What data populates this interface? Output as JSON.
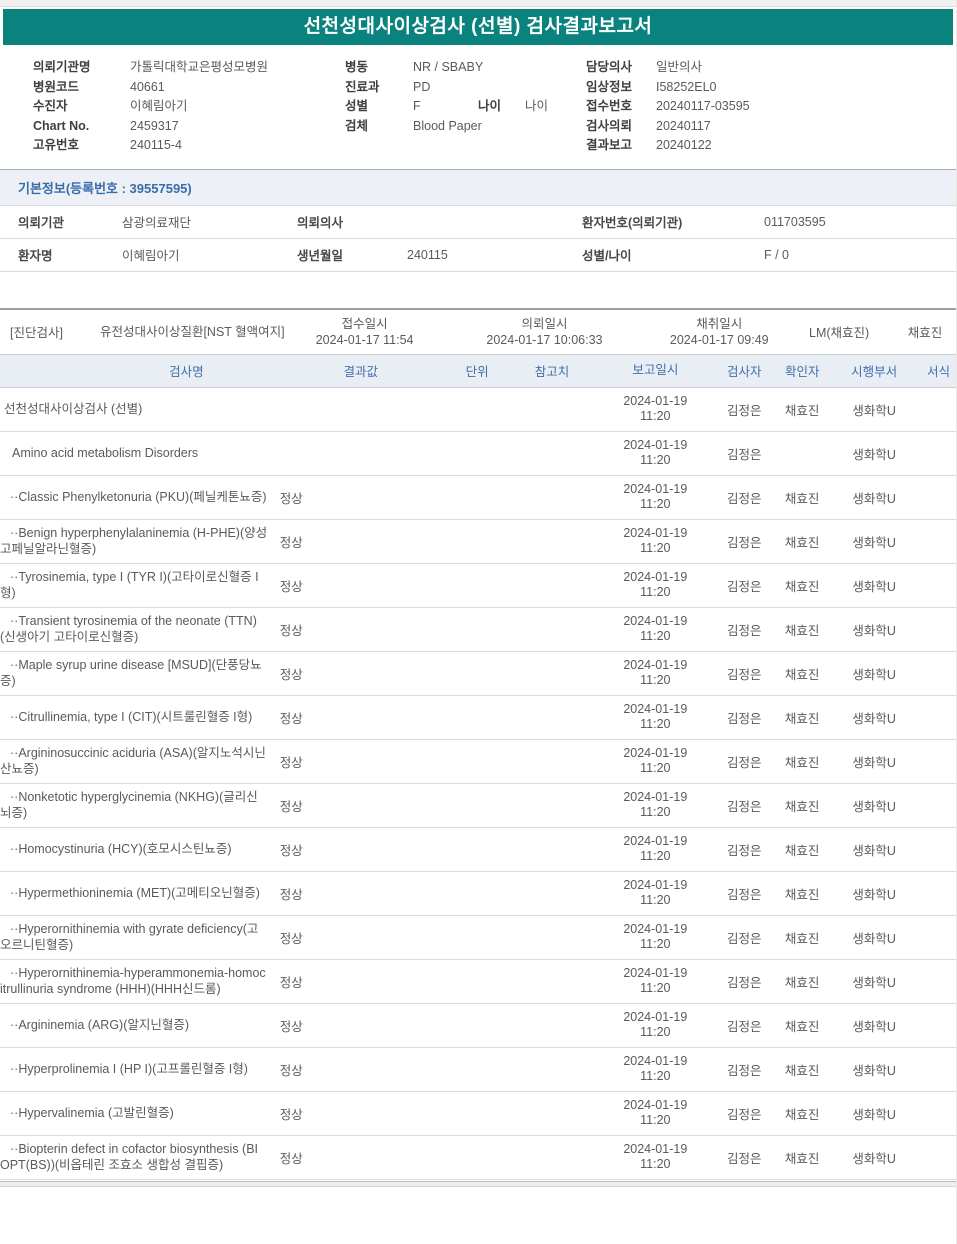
{
  "report_title": "선천성대사이상검사 (선별) 검사결과보고서",
  "colors": {
    "header_teal": "#0A827E",
    "section_title_blue": "#3A6CA9",
    "table_header_blue": "#4070AC",
    "body_text": "#595A5C"
  },
  "patient_header": {
    "col1": [
      {
        "l": "의뢰기관명",
        "v": "가톨릭대학교은평성모병원"
      },
      {
        "l": "병원코드",
        "v": "40661"
      },
      {
        "l": "수진자",
        "v": "이혜림아기"
      },
      {
        "l": "Chart No.",
        "v": "2459317"
      },
      {
        "l": "고유번호",
        "v": "240115-4"
      }
    ],
    "col2": [
      {
        "l": "병동",
        "v": "NR / SBABY",
        "l2": "",
        "v2": ""
      },
      {
        "l": "진료과",
        "v": "PD",
        "l2": "",
        "v2": ""
      },
      {
        "l": "성별",
        "v": "F",
        "l2": "나이",
        "v2": "나이"
      },
      {
        "l": "검체",
        "v": "Blood Paper",
        "l2": "",
        "v2": ""
      }
    ],
    "col3": [
      {
        "l": "담당의사",
        "v": "일반의사"
      },
      {
        "l": "임상정보",
        "v": "I58252EL0"
      },
      {
        "l": "접수번호",
        "v": "20240117-03595"
      },
      {
        "l": "검사의뢰",
        "v": "20240117"
      },
      {
        "l": "결과보고",
        "v": "20240122"
      }
    ]
  },
  "basic_info": {
    "title": "기본정보(등록번호 : 39557595)",
    "rows": [
      {
        "l1": "의뢰기관",
        "v1": "삼광의료재단",
        "l2": "의뢰의사",
        "v2": "",
        "l3": "환자번호(의뢰기관)",
        "v3": "011703595"
      },
      {
        "l1": "환자명",
        "v1": "이혜림아기",
        "l2": "생년월일",
        "v2": "240115",
        "l3": "성별/나이",
        "v3": "F / 0"
      }
    ]
  },
  "order": {
    "category": "[진단검사]",
    "group": "유전성대사이상질환[NST 혈액여지]",
    "received_label": "접수일시",
    "received": "2024-01-17 11:54",
    "requested_label": "의뢰일시",
    "requested": "2024-01-17 10:06:33",
    "collected_label": "채취일시",
    "collected": "2024-01-17 09:49",
    "collector": "LM(채효진)",
    "receiver": "채효진"
  },
  "results": {
    "headers": {
      "name": "검사명",
      "result": "결과값",
      "unit": "단위",
      "ref": "참고치",
      "reported": "보고일시",
      "tester": "검사자",
      "verifier": "확인자",
      "dept": "시행부서",
      "form": "서식"
    },
    "rows": [
      {
        "level": 0,
        "name": "선천성대사이상검사 (선별)",
        "result": "",
        "unit": "",
        "ref": "",
        "reported_date": "2024-01-19",
        "reported_time": "11:20",
        "tester": "김정은",
        "verifier": "채효진",
        "dept": "생화학U",
        "form": ""
      },
      {
        "level": 1,
        "name": "Amino acid metabolism Disorders",
        "result": "",
        "unit": "",
        "ref": "",
        "reported_date": "2024-01-19",
        "reported_time": "11:20",
        "tester": "김정은",
        "verifier": "",
        "dept": "생화학U",
        "form": ""
      },
      {
        "level": 2,
        "name": "··Classic Phenylketonuria (PKU)(페닐케톤뇨증)",
        "result": "정상",
        "unit": "",
        "ref": "",
        "reported_date": "2024-01-19",
        "reported_time": "11:20",
        "tester": "김정은",
        "verifier": "채효진",
        "dept": "생화학U",
        "form": ""
      },
      {
        "level": 2,
        "name": "··Benign hyperphenylalaninemia (H-PHE)(양성 고페닐알라닌혈증)",
        "result": "정상",
        "unit": "",
        "ref": "",
        "reported_date": "2024-01-19",
        "reported_time": "11:20",
        "tester": "김정은",
        "verifier": "채효진",
        "dept": "생화학U",
        "form": ""
      },
      {
        "level": 2,
        "name": "··Tyrosinemia, type I (TYR I)(고타이로신혈증 I형)",
        "result": "정상",
        "unit": "",
        "ref": "",
        "reported_date": "2024-01-19",
        "reported_time": "11:20",
        "tester": "김정은",
        "verifier": "채효진",
        "dept": "생화학U",
        "form": ""
      },
      {
        "level": 2,
        "name": "··Transient tyrosinemia of the neonate (TTN)(신생아기 고타이로신혈증)",
        "result": "정상",
        "unit": "",
        "ref": "",
        "reported_date": "2024-01-19",
        "reported_time": "11:20",
        "tester": "김정은",
        "verifier": "채효진",
        "dept": "생화학U",
        "form": ""
      },
      {
        "level": 2,
        "name": "··Maple syrup urine disease [MSUD](단풍당뇨증)",
        "result": "정상",
        "unit": "",
        "ref": "",
        "reported_date": "2024-01-19",
        "reported_time": "11:20",
        "tester": "김정은",
        "verifier": "채효진",
        "dept": "생화학U",
        "form": ""
      },
      {
        "level": 2,
        "name": "··Citrullinemia, type I (CIT)(시트룰린혈증 I형)",
        "result": "정상",
        "unit": "",
        "ref": "",
        "reported_date": "2024-01-19",
        "reported_time": "11:20",
        "tester": "김정은",
        "verifier": "채효진",
        "dept": "생화학U",
        "form": ""
      },
      {
        "level": 2,
        "name": "··Argininosuccinic aciduria (ASA)(알지노석시닌산뇨증)",
        "result": "정상",
        "unit": "",
        "ref": "",
        "reported_date": "2024-01-19",
        "reported_time": "11:20",
        "tester": "김정은",
        "verifier": "채효진",
        "dept": "생화학U",
        "form": ""
      },
      {
        "level": 2,
        "name": "··Nonketotic hyperglycinemia (NKHG)(글리신뇌증)",
        "result": "정상",
        "unit": "",
        "ref": "",
        "reported_date": "2024-01-19",
        "reported_time": "11:20",
        "tester": "김정은",
        "verifier": "채효진",
        "dept": "생화학U",
        "form": ""
      },
      {
        "level": 2,
        "name": "··Homocystinuria (HCY)(호모시스틴뇨증)",
        "result": "정상",
        "unit": "",
        "ref": "",
        "reported_date": "2024-01-19",
        "reported_time": "11:20",
        "tester": "김정은",
        "verifier": "채효진",
        "dept": "생화학U",
        "form": ""
      },
      {
        "level": 2,
        "name": "··Hypermethioninemia (MET)(고메티오닌혈증)",
        "result": "정상",
        "unit": "",
        "ref": "",
        "reported_date": "2024-01-19",
        "reported_time": "11:20",
        "tester": "김정은",
        "verifier": "채효진",
        "dept": "생화학U",
        "form": ""
      },
      {
        "level": 2,
        "name": "··Hyperornithinemia with gyrate deficiency(고오르니틴혈증)",
        "result": "정상",
        "unit": "",
        "ref": "",
        "reported_date": "2024-01-19",
        "reported_time": "11:20",
        "tester": "김정은",
        "verifier": "채효진",
        "dept": "생화학U",
        "form": ""
      },
      {
        "level": 2,
        "name": "··Hyperornithinemia-hyperammonemia-homocitrullinuria syndrome (HHH)(HHH신드롬)",
        "result": "정상",
        "unit": "",
        "ref": "",
        "reported_date": "2024-01-19",
        "reported_time": "11:20",
        "tester": "김정은",
        "verifier": "채효진",
        "dept": "생화학U",
        "form": ""
      },
      {
        "level": 2,
        "name": "··Argininemia (ARG)(알지닌혈증)",
        "result": "정상",
        "unit": "",
        "ref": "",
        "reported_date": "2024-01-19",
        "reported_time": "11:20",
        "tester": "김정은",
        "verifier": "채효진",
        "dept": "생화학U",
        "form": ""
      },
      {
        "level": 2,
        "name": "··Hyperprolinemia I (HP I)(고프롤린혈증 I형)",
        "result": "정상",
        "unit": "",
        "ref": "",
        "reported_date": "2024-01-19",
        "reported_time": "11:20",
        "tester": "김정은",
        "verifier": "채효진",
        "dept": "생화학U",
        "form": ""
      },
      {
        "level": 2,
        "name": "··Hypervalinemia (고발린혈증)",
        "result": "정상",
        "unit": "",
        "ref": "",
        "reported_date": "2024-01-19",
        "reported_time": "11:20",
        "tester": "김정은",
        "verifier": "채효진",
        "dept": "생화학U",
        "form": ""
      },
      {
        "level": 2,
        "name": "··Biopterin defect in cofactor biosynthesis (BIOPT(BS))(비옵테린 조효소 생합성 결핍증)",
        "result": "정상",
        "unit": "",
        "ref": "",
        "reported_date": "2024-01-19",
        "reported_time": "11:20",
        "tester": "김정은",
        "verifier": "채효진",
        "dept": "생화학U",
        "form": ""
      }
    ]
  }
}
